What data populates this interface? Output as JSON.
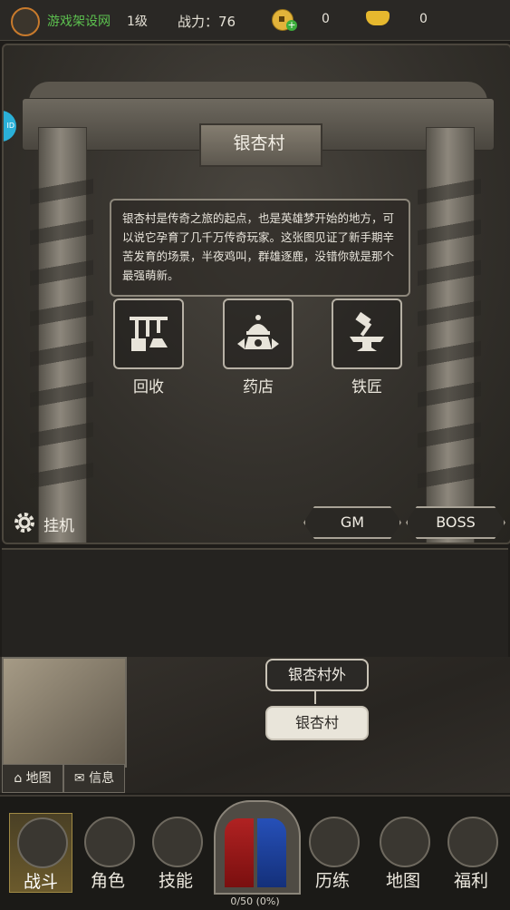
{
  "topbar": {
    "site_name": "游戏架设网",
    "level": "1级",
    "power_label": "战力：",
    "power_value": "76",
    "copper": "0",
    "ingot": "0"
  },
  "scene": {
    "village_name": "银杏村",
    "description": "银杏村是传奇之旅的起点，也是英雄梦开始的地方，可以说它孕育了几千万传奇玩家。这张图见证了新手期辛苦发育的场景，半夜鸡叫，群雄逐鹿，没错你就是那个最强萌新。",
    "functions": [
      {
        "label": "回收",
        "icon": "recycle-icon"
      },
      {
        "label": "药店",
        "icon": "pharmacy-icon"
      },
      {
        "label": "铁匠",
        "icon": "anvil-icon"
      }
    ],
    "afk_label": "挂机",
    "gm_label": "GM",
    "boss_label": "BOSS"
  },
  "map": {
    "map_button": "地图",
    "info_button": "信息",
    "outer_location": "银杏村外",
    "current_location": "银杏村"
  },
  "nav": {
    "items": [
      {
        "label": "战斗",
        "icon": "crossed-swords-icon"
      },
      {
        "label": "角色",
        "icon": "helmet-icon"
      },
      {
        "label": "技能",
        "icon": "flame-icon"
      },
      {
        "label": "历练",
        "icon": "vortex-icon"
      },
      {
        "label": "地图",
        "icon": "map-pin-icon"
      },
      {
        "label": "福利",
        "icon": "chest-icon"
      }
    ],
    "exp_text": "0/50 (0%)"
  },
  "colors": {
    "site_name": "#5cc14f",
    "portal_red": "#b02222",
    "portal_blue": "#2650b8"
  }
}
